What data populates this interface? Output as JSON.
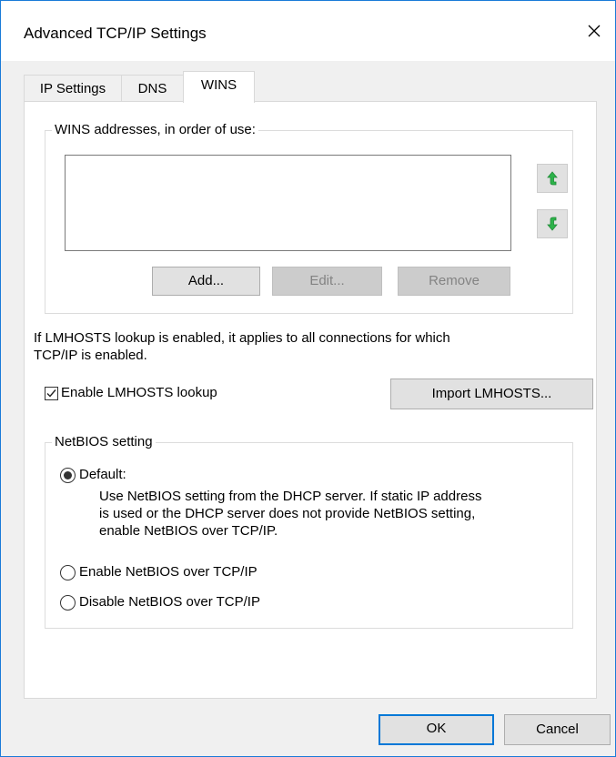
{
  "window": {
    "title": "Advanced TCP/IP Settings",
    "close_glyph": "✕"
  },
  "tabs": [
    {
      "label": "IP Settings",
      "active": false
    },
    {
      "label": "DNS",
      "active": false
    },
    {
      "label": "WINS",
      "active": true
    }
  ],
  "wins": {
    "group_label": "WINS addresses, in order of use:",
    "addresses": [],
    "up_icon": "arrow-up-icon",
    "down_icon": "arrow-down-icon",
    "icon_color": "#2db34a",
    "add_label": "Add...",
    "edit_label": "Edit...",
    "remove_label": "Remove"
  },
  "lmhosts": {
    "info_line1": "If LMHOSTS lookup is enabled, it applies to all connections for which",
    "info_line2": "TCP/IP is enabled.",
    "enable_label": "Enable LMHOSTS lookup",
    "enable_checked": true,
    "import_label": "Import LMHOSTS..."
  },
  "netbios": {
    "group_label": "NetBIOS setting",
    "default_label": "Default:",
    "default_desc_line1": "Use NetBIOS setting from the DHCP server. If static IP address",
    "default_desc_line2": "is used or the DHCP server does not provide NetBIOS setting,",
    "default_desc_line3": "enable NetBIOS over TCP/IP.",
    "enable_label": "Enable NetBIOS over TCP/IP",
    "disable_label": "Disable NetBIOS over TCP/IP",
    "selected": "default"
  },
  "footer": {
    "ok_label": "OK",
    "cancel_label": "Cancel"
  }
}
